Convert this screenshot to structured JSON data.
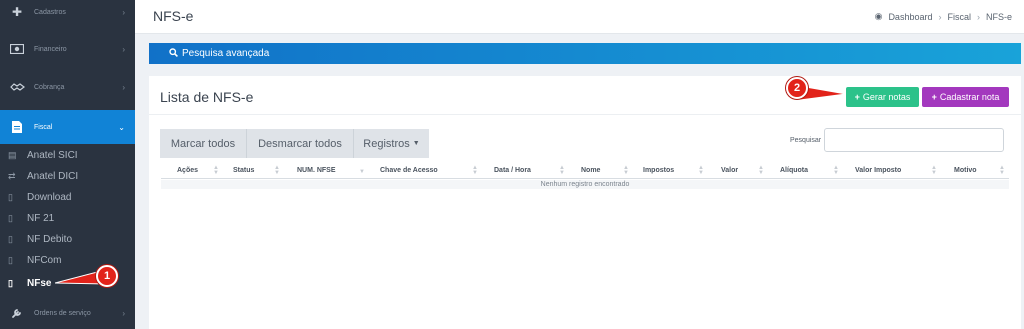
{
  "sidebar": {
    "main_items": [
      {
        "label": "Cadastros",
        "icon": "plus-icon",
        "active": false
      },
      {
        "label": "Financeiro",
        "icon": "money-icon",
        "active": false
      },
      {
        "label": "Cobrança",
        "icon": "handshake-icon",
        "active": false
      },
      {
        "label": "Fiscal",
        "icon": "document-icon",
        "active": true
      },
      {
        "label": "Ordens de serviço",
        "icon": "wrench-icon",
        "active": false
      }
    ],
    "sub_items": [
      {
        "label": "Anatel SICI",
        "icon": "calendar-icon"
      },
      {
        "label": "Anatel DICI",
        "icon": "exchange-icon"
      },
      {
        "label": "Download",
        "icon": "file-icon"
      },
      {
        "label": "NF 21",
        "icon": "file-icon"
      },
      {
        "label": "NF Debito",
        "icon": "file-icon"
      },
      {
        "label": "NFCom",
        "icon": "file-icon"
      },
      {
        "label": "NFse",
        "icon": "file-icon",
        "current": true
      }
    ]
  },
  "header": {
    "title": "NFS-e",
    "breadcrumb": [
      "Dashboard",
      "Fiscal",
      "NFS-e"
    ]
  },
  "advanced_search": {
    "label": "Pesquisa avançada"
  },
  "list": {
    "title": "Lista de NFS-e",
    "gerar_label": "Gerar notas",
    "cadastrar_label": "Cadastrar nota",
    "toolbar": {
      "marcar": "Marcar todos",
      "desmarcar": "Desmarcar todos",
      "registros": "Registros"
    },
    "search": {
      "label": "Pesquisar",
      "value": "",
      "placeholder": ""
    },
    "columns": [
      "Ações",
      "Status",
      "NUM. NFSE",
      "Chave de Acesso",
      "Data / Hora",
      "Nome",
      "Impostos",
      "Valor",
      "Alíquota",
      "Valor Imposto",
      "Motivo"
    ],
    "empty_message": "Nenhum registro encontrado"
  },
  "annotations": {
    "badge_1": "1",
    "badge_2": "2"
  },
  "colors": {
    "sidebar_bg": "#2a3340",
    "active_blue": "#1183d6",
    "gerar_green": "#2cc28a",
    "cadastrar_purple": "#a338be",
    "callout_red": "#e2231a"
  }
}
